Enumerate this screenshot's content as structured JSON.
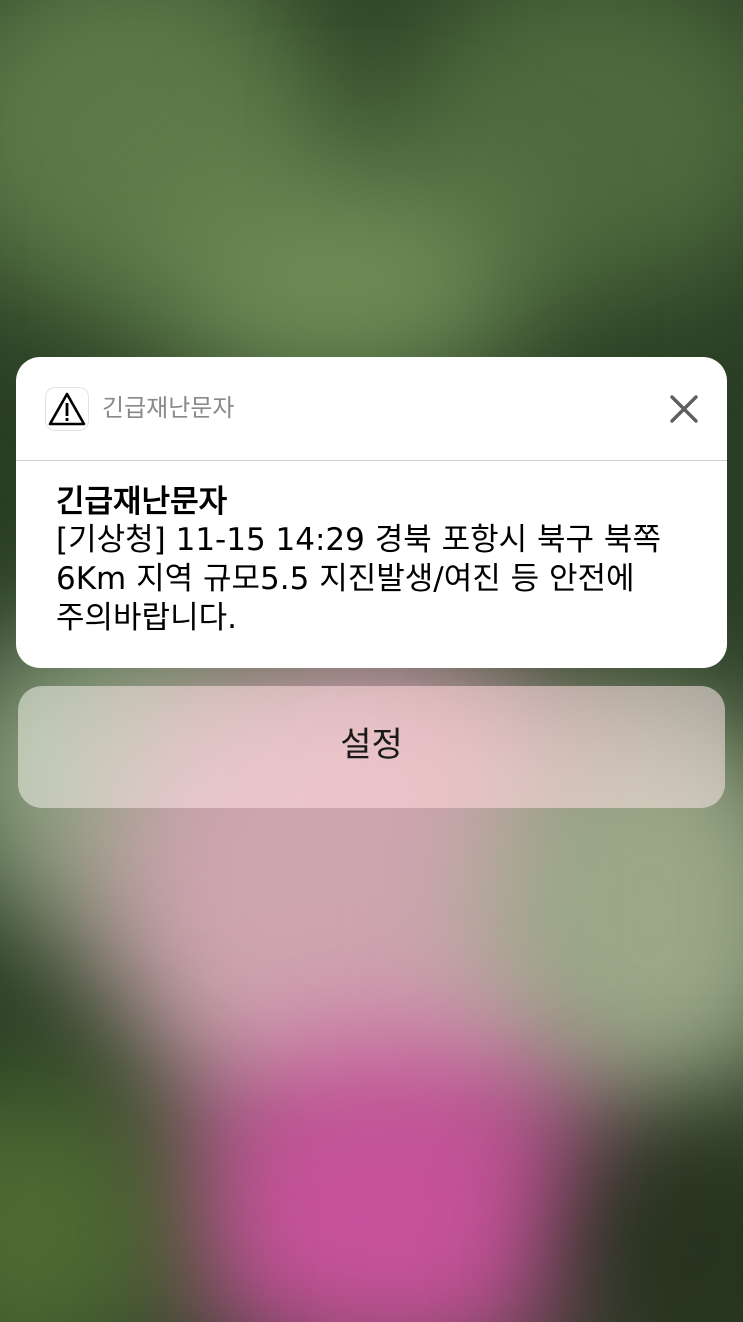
{
  "notification": {
    "app_icon": "warning-triangle-icon",
    "app_name": "긴급재난문자",
    "close_icon": "close-icon",
    "title": "긴급재난문자",
    "body_lines": [
      "[기상청] 11-15 14:29 경북 포항시 북구 북쪽",
      "6Km 지역 규모5.5 지진발생/여진 등 안전에",
      "주의바랍니다."
    ]
  },
  "actions": {
    "settings_label": "설정"
  }
}
